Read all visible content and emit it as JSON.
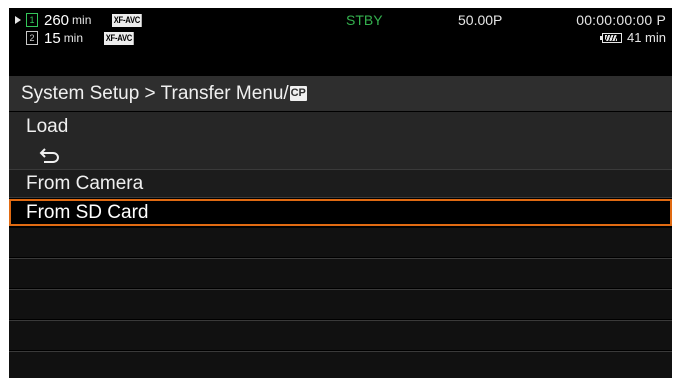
{
  "status": {
    "slot1_number": "1",
    "slot1_remaining": "260",
    "slot1_unit": "min",
    "slot1_format": "XF-AVC",
    "slot2_number": "2",
    "slot2_remaining": "15",
    "slot2_unit": "min",
    "slot2_format": "XF-AVC",
    "mode": "STBY",
    "frame_rate": "50.00P",
    "timecode": "00:00:00:00 P",
    "battery_remaining": "41 min",
    "mode_color": "#34b04e"
  },
  "menu": {
    "breadcrumb": "System Setup > Transfer Menu/",
    "cp_badge": "CP",
    "section_label": "Load",
    "back_icon": "return-arrow-icon",
    "items": [
      {
        "label": "From Camera",
        "selected": false
      },
      {
        "label": "From SD Card",
        "selected": true
      }
    ],
    "accent_color": "#e06a12"
  }
}
